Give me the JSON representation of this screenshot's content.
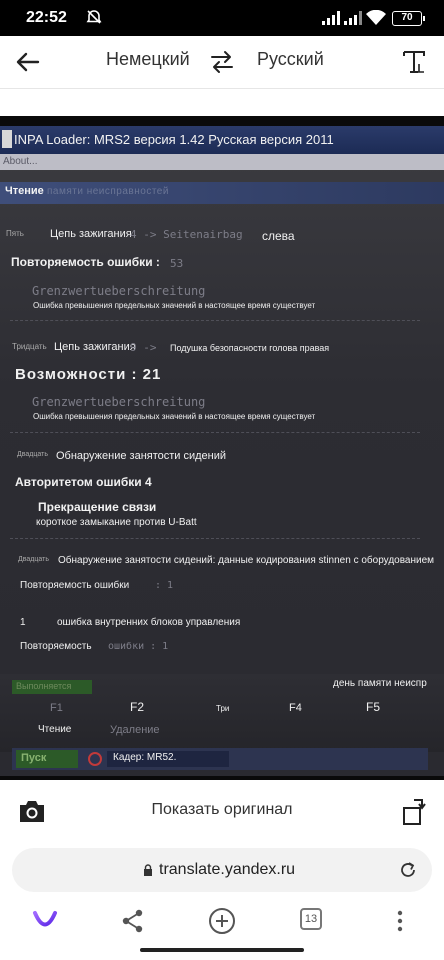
{
  "status": {
    "time": "22:52",
    "battery": "70"
  },
  "header": {
    "lang_from": "Немецкий",
    "lang_to": "Русский"
  },
  "screen": {
    "title": "INPA Loader: MRS2 версия 1.42 Русская версия 2011",
    "menu": "About...",
    "section_label": "Чтение",
    "section_ghost": "памяти неисправностей",
    "e1": {
      "tag": "Пять",
      "label": "Цепь зажигания",
      "ghost": "4  -> Seitenairbag",
      "side": "слева",
      "repeat": "Повторяемость ошибки :",
      "repeat_ghost": "53",
      "code": "Grenzwertueberschreitung",
      "desc": "Ошибка превышения предельных значений в настоящее время существует"
    },
    "e2": {
      "tag": "Тридцать",
      "label": "Цепь зажигания",
      "ghost": "9  ->",
      "text": "Подушка безопасности голова правая",
      "big": "Возможности : 21",
      "code": "Grenzwertueberschreitung",
      "desc": "Ошибка превышения предельных значений в настоящее время существует"
    },
    "e3": {
      "tag": "Двадцать",
      "label": "Обнаружение занятости сидений",
      "auth": "Авторитетом ошибки 4",
      "comm": "Прекращение связи",
      "short": "короткое замыкание против U-Batt"
    },
    "e4": {
      "tag": "Двадцать",
      "label": "Обнаружение занятости сидений: данные кодирования stinnen с оборудованием",
      "repeat": "Повторяемость ошибки",
      "repeat_ghost": ":  1",
      "num": "1",
      "blocks": "ошибка внутренних блоков управления",
      "repeat2": "Повторяемость",
      "repeat2_ghost": "ошибки :  1"
    },
    "fbar": {
      "running": "Выполняется",
      "day": "день памяти неиспр",
      "f1": "F1",
      "f2": "F2",
      "f3": "Три",
      "f4": "F4",
      "f5": "F5",
      "read": "Чтение",
      "delete": "Удаление"
    },
    "statusline": {
      "start": "Пуск",
      "frame": "Кадер: MR52."
    }
  },
  "bottom": {
    "show_original": "Показать оригинал",
    "url": "translate.yandex.ru",
    "tabs_count": "13"
  },
  "colors": {
    "accent_purple": "#7b3ff2",
    "screen_title_bar": "#1c2b55",
    "start_green": "#2c5a28"
  }
}
